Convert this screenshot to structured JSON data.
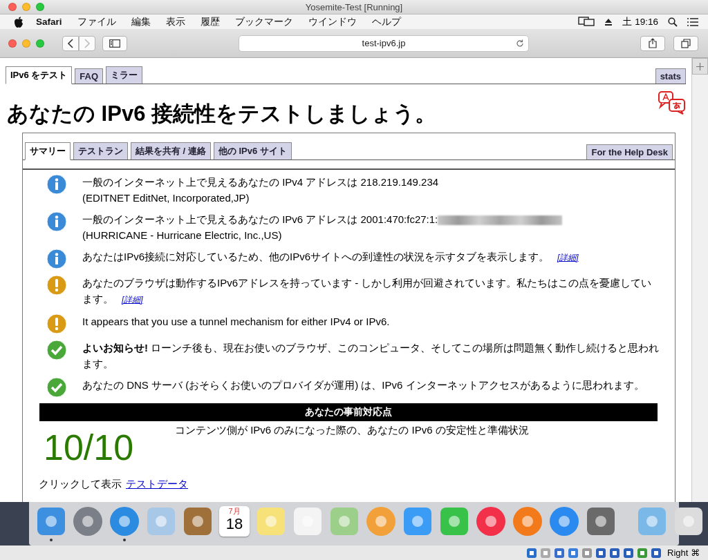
{
  "vm_window": {
    "title": "Yosemite-Test [Running]"
  },
  "menu_bar": {
    "app": "Safari",
    "items": [
      "ファイル",
      "編集",
      "表示",
      "履歴",
      "ブックマーク",
      "ウインドウ",
      "ヘルプ"
    ],
    "clock": "土 19:16"
  },
  "browser": {
    "address": "test-ipv6.jp"
  },
  "site_tabs": [
    {
      "label": "IPv6 をテスト",
      "selected": true
    },
    {
      "label": "FAQ",
      "selected": false
    },
    {
      "label": "ミラー",
      "selected": false
    }
  ],
  "stats_tab": "stats",
  "heading": "あなたの IPv6 接続性をテストしましょう。",
  "inner_tabs": [
    {
      "label": "サマリー",
      "selected": true
    },
    {
      "label": "テストラン",
      "selected": false
    },
    {
      "label": "結果を共有 / 連絡",
      "selected": false
    },
    {
      "label": "他の IPv6 サイト",
      "selected": false
    }
  ],
  "help_desk_tab": "For the Help Desk",
  "messages": [
    {
      "kind": "info",
      "text": "一般のインターネット上で見えるあなたの IPv4 アドレスは 218.219.149.234",
      "second_line": "(EDITNET EditNet, Incorporated,JP)"
    },
    {
      "kind": "info",
      "text": "一般のインターネット上で見えるあなたの IPv6 アドレスは 2001:470:fc27:1:",
      "redacted": true,
      "second_line": "(HURRICANE - Hurricane Electric, Inc.,US)"
    },
    {
      "kind": "info",
      "text": "あなたはIPv6接続に対応しているため、他のIPv6サイトへの到達性の状況を示すタブを表示します。",
      "link": "[詳細]"
    },
    {
      "kind": "warning",
      "text": "あなたのブラウザは動作するIPv6アドレスを持っています - しかし利用が回避されています。私たちはこの点を憂慮しています。",
      "link": "[詳細]"
    },
    {
      "kind": "warning",
      "text": "It appears that you use a tunnel mechanism for either IPv4 or IPv6."
    },
    {
      "kind": "ok",
      "text": "**よいお知らせ!** ローンチ後も、現在お使いのブラウザ、このコンピュータ、そしてこの場所は問題無く動作し続けると思われます。"
    },
    {
      "kind": "ok",
      "text": "あなたの DNS サーバ (おそらくお使いのプロバイダが運用) は、IPv6 インターネットアクセスがあるように思われます。"
    }
  ],
  "score": {
    "title": "あなたの事前対応点",
    "value": "10/10",
    "description": "コンテンツ側が IPv6 のみになった際の、あなたの IPv6 の安定性と準備状況"
  },
  "test_data": {
    "label": "クリックして表示",
    "link": "テストデータ"
  },
  "dock": [
    {
      "kind": "finder",
      "running": true
    },
    {
      "kind": "launchpad",
      "running": false
    },
    {
      "kind": "safari",
      "running": true
    },
    {
      "kind": "mail",
      "running": false
    },
    {
      "kind": "contacts",
      "running": false
    },
    {
      "kind": "calendar",
      "running": false,
      "month": "7月",
      "day": "18"
    },
    {
      "kind": "notes",
      "running": false
    },
    {
      "kind": "reminders",
      "running": false
    },
    {
      "kind": "maps",
      "running": false
    },
    {
      "kind": "photos",
      "running": false
    },
    {
      "kind": "messages",
      "running": false
    },
    {
      "kind": "facetime",
      "running": false
    },
    {
      "kind": "music",
      "running": false
    },
    {
      "kind": "books",
      "running": false
    },
    {
      "kind": "appstore",
      "running": false
    },
    {
      "kind": "settings",
      "running": false
    },
    {
      "kind": "divider"
    },
    {
      "kind": "downloads",
      "running": false
    },
    {
      "kind": "trash",
      "running": false
    }
  ],
  "vm_status": {
    "host_key": "Right ⌘"
  }
}
